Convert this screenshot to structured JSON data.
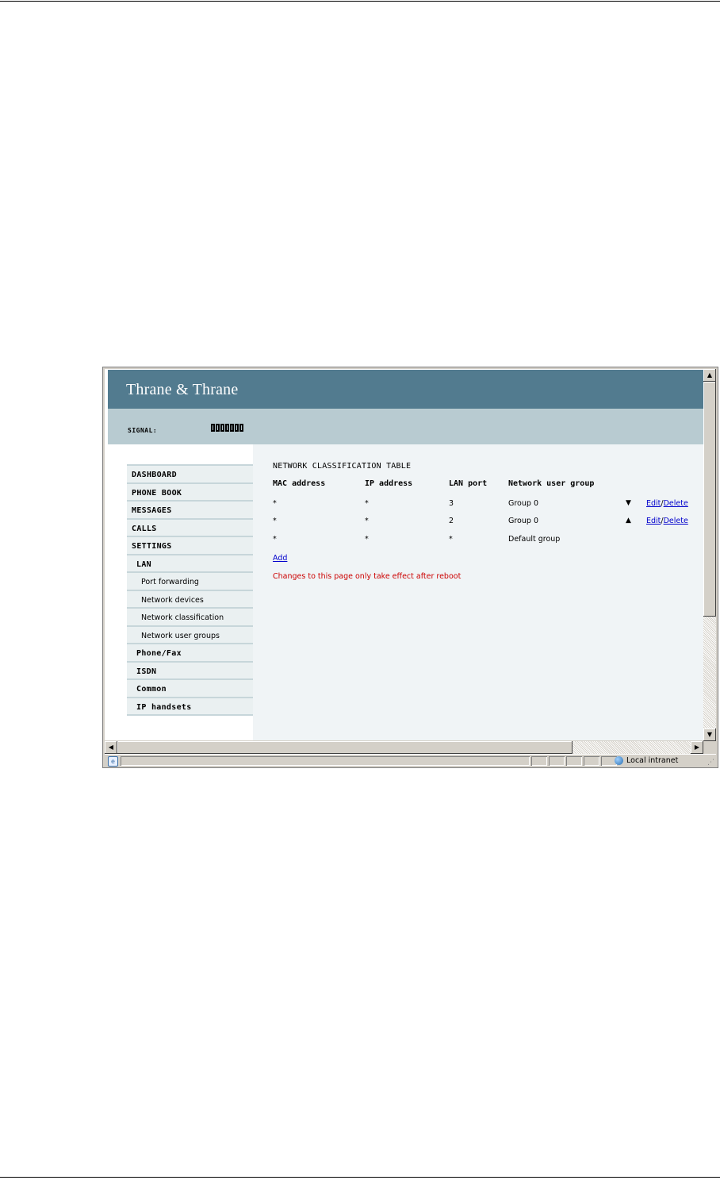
{
  "brand": {
    "logo_text": "Thrane & Thrane"
  },
  "signal": {
    "label": "SIGNAL:",
    "level_filled": 7,
    "level_total": 7
  },
  "sidebar": {
    "items": [
      {
        "label": "DASHBOARD",
        "level": 0
      },
      {
        "label": "PHONE BOOK",
        "level": 0
      },
      {
        "label": "MESSAGES",
        "level": 0
      },
      {
        "label": "CALLS",
        "level": 0
      },
      {
        "label": "SETTINGS",
        "level": 0
      },
      {
        "label": "LAN",
        "level": 1
      },
      {
        "label": "Port forwarding",
        "level": 2
      },
      {
        "label": "Network devices",
        "level": 2
      },
      {
        "label": "Network classification",
        "level": 2
      },
      {
        "label": "Network user groups",
        "level": 2
      },
      {
        "label": "Phone/Fax",
        "level": 1
      },
      {
        "label": "ISDN",
        "level": 1
      },
      {
        "label": "Common",
        "level": 1
      },
      {
        "label": "IP handsets",
        "level": 1
      }
    ]
  },
  "main": {
    "title": "NETWORK CLASSIFICATION TABLE",
    "columns": [
      "MAC address",
      "IP address",
      "LAN port",
      "Network user group"
    ],
    "rows": [
      {
        "mac": "*",
        "ip": "*",
        "port": "3",
        "group": "Group 0",
        "arrow": "▼",
        "edit": "Edit",
        "sep": "/",
        "delete": "Delete"
      },
      {
        "mac": "*",
        "ip": "*",
        "port": "2",
        "group": "Group 0",
        "arrow": "▲",
        "edit": "Edit",
        "sep": "/",
        "delete": "Delete"
      },
      {
        "mac": "*",
        "ip": "*",
        "port": "*",
        "group": "Default group"
      }
    ],
    "add_label": "Add",
    "note": "Changes to this page only take effect after reboot"
  },
  "statusbar": {
    "zone": "Local intranet"
  },
  "colors": {
    "brand_bar": "#527b8f",
    "signal_bar": "#b8cbd1",
    "main_bg": "#f0f4f6",
    "note": "#cc0000",
    "link": "#0000cc"
  }
}
